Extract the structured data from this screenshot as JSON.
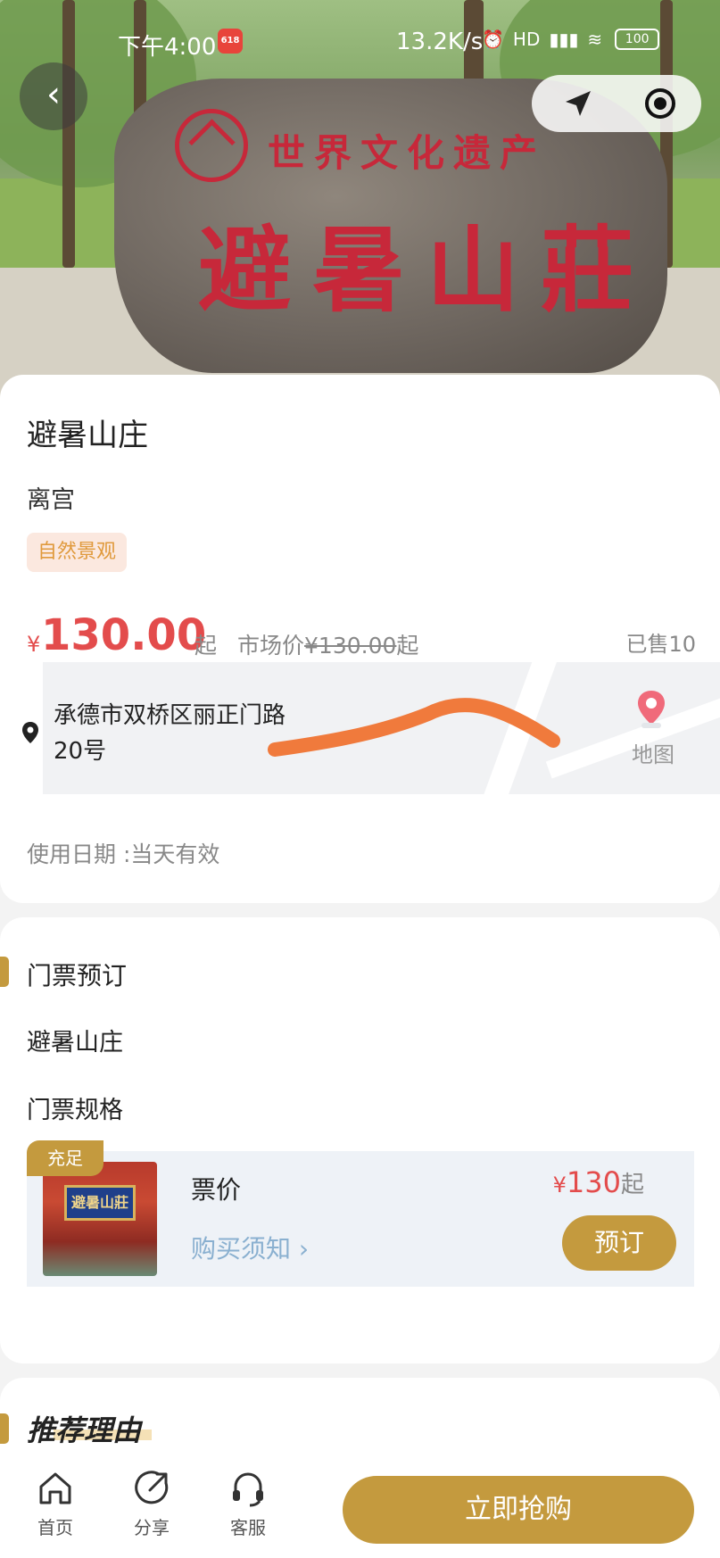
{
  "status_bar": {
    "time": "下午4:00",
    "badge": "618",
    "network_speed": "13.2K/s",
    "signal": "HD",
    "battery": "100"
  },
  "hero": {
    "stone_subtitle": "世界文化遗产",
    "stone_title": "避暑山莊"
  },
  "scenic": {
    "name": "避暑山庄",
    "alias": "离宫",
    "tag": "自然景观",
    "currency": "¥",
    "price": "130.00",
    "price_suffix": "起",
    "market_price_label": "市场价",
    "market_price": "¥130.00",
    "market_price_suffix": "起",
    "sold": "已售10",
    "address_line1": "承德市双桥区丽正门路",
    "address_line2": "20号",
    "map_label": "地图",
    "use_date": "使用日期 :当天有效"
  },
  "tickets": {
    "section_title": "门票预订",
    "venue": "避暑山庄",
    "spec_label": "门票规格",
    "items": [
      {
        "stock": "充足",
        "plaque_text": "避暑山莊",
        "name": "票价",
        "notice": "购买须知",
        "currency": "¥",
        "price": "130",
        "price_suffix": "起",
        "book_label": "预订"
      }
    ]
  },
  "recommend": {
    "title": "推荐理由"
  },
  "bottom_bar": {
    "tabs": [
      {
        "label": "首页",
        "icon": "home-icon"
      },
      {
        "label": "分享",
        "icon": "share-icon"
      },
      {
        "label": "客服",
        "icon": "headset-icon"
      }
    ],
    "buy_label": "立即抢购"
  },
  "colors": {
    "accent": "#c49a3e",
    "price": "#e34c4c",
    "tag_text": "#e09a3d",
    "tag_bg": "#fbe8df"
  }
}
